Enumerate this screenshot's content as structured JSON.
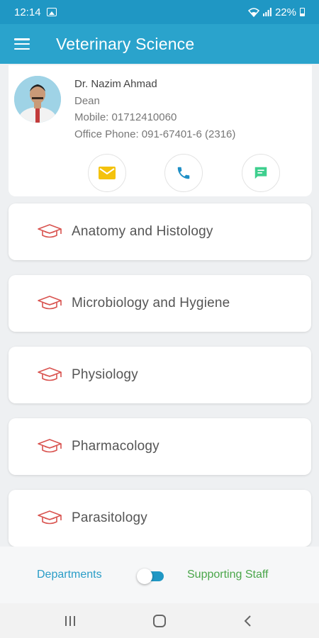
{
  "status_bar": {
    "time": "12:14",
    "battery": "22%",
    "icons": [
      "image-icon",
      "wifi-icon",
      "signal-icon",
      "battery-icon"
    ]
  },
  "app_bar": {
    "title": "Veterinary Science",
    "menu_icon": "hamburger-menu-icon",
    "color": "#2aa3cc"
  },
  "profile": {
    "name": "Dr. Nazim  Ahmad",
    "designation": "Dean",
    "mobile": "Mobile: 01712410060",
    "office_phone": "Office Phone: 091-67401-6 (2316)",
    "actions": [
      {
        "icon": "email-icon",
        "color": "#f4c20d"
      },
      {
        "icon": "phone-icon",
        "color": "#1f8fc6"
      },
      {
        "icon": "message-icon",
        "color": "#3ecf8e"
      }
    ]
  },
  "departments": [
    {
      "label": "Anatomy and Histology",
      "icon": "graduation-cap-icon"
    },
    {
      "label": "Microbiology and Hygiene",
      "icon": "graduation-cap-icon"
    },
    {
      "label": "Physiology",
      "icon": "graduation-cap-icon"
    },
    {
      "label": "Pharmacology",
      "icon": "graduation-cap-icon"
    },
    {
      "label": "Parasitology",
      "icon": "graduation-cap-icon"
    }
  ],
  "toggle": {
    "left_label": "Departments",
    "right_label": "Supporting Staff",
    "left_color": "#2a9dc7",
    "right_color": "#4aa64a"
  },
  "nav_bar": {
    "icons": [
      "recent-apps-icon",
      "home-icon",
      "back-icon"
    ]
  },
  "colors": {
    "accent": "#2aa3cc",
    "cap_icon": "#d9534f",
    "background": "#eef0f2"
  }
}
